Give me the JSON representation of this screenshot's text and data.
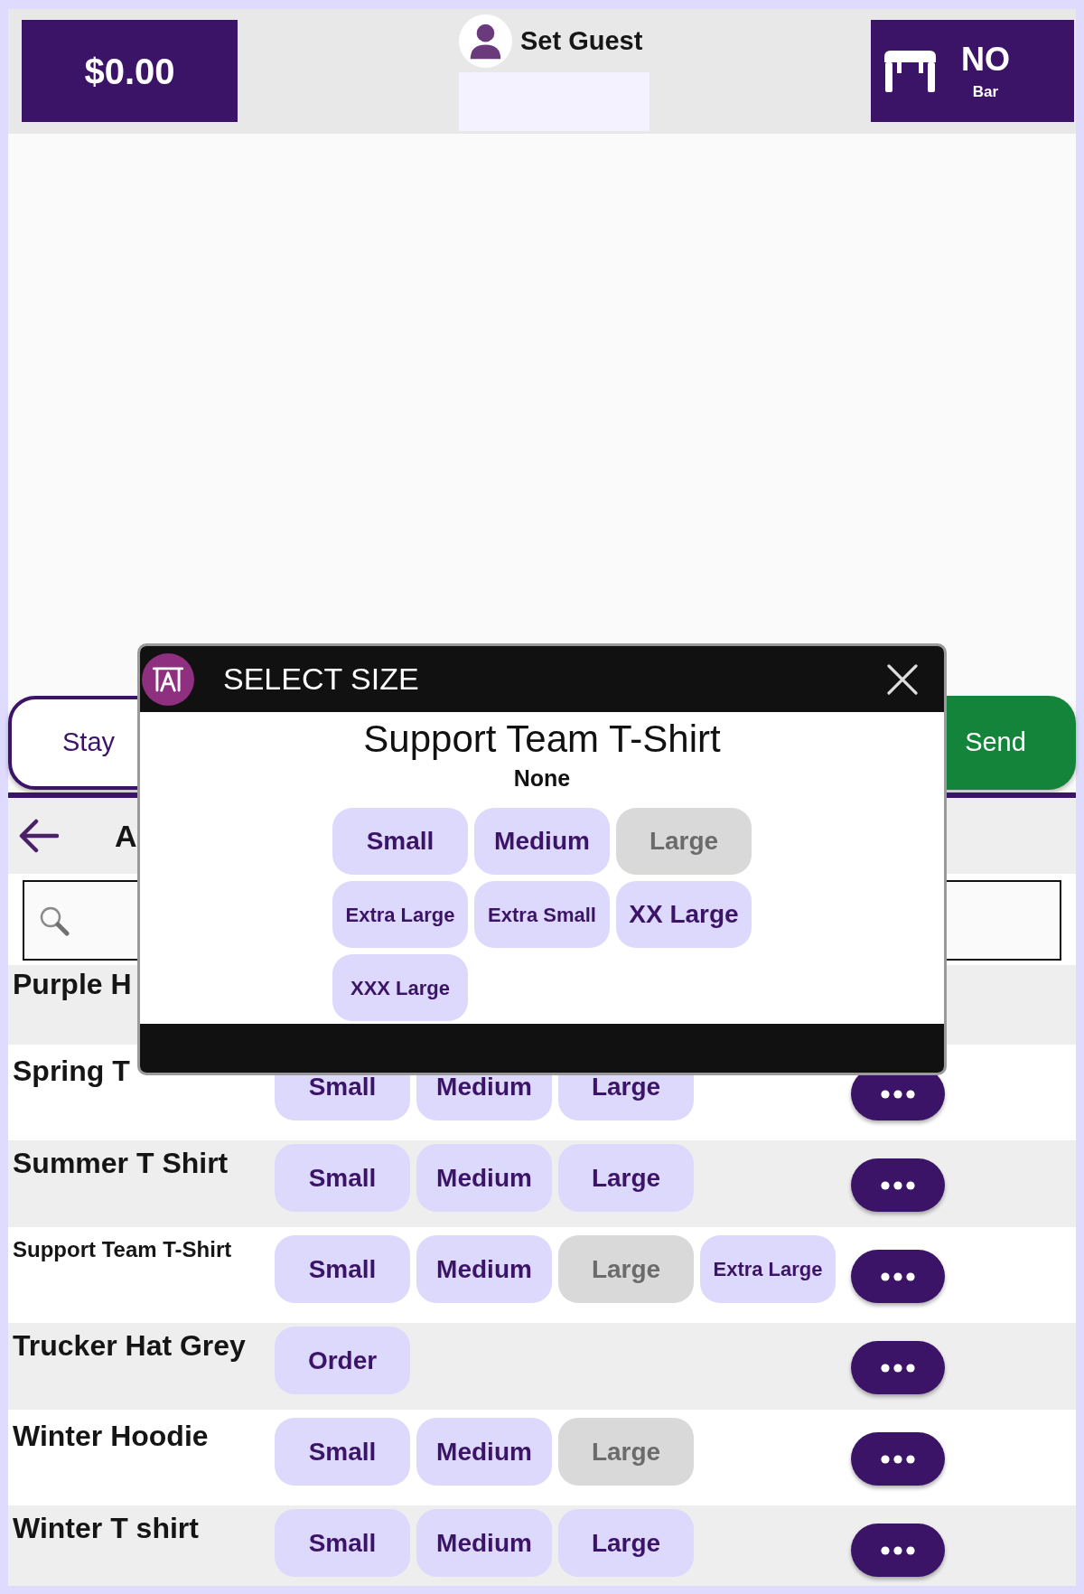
{
  "top_bar": {
    "total": "$0.00",
    "guest_label": "Set Guest",
    "table": {
      "status": "NO",
      "area": "Bar"
    }
  },
  "actions": [
    {
      "kind": "outline",
      "label": "Stay"
    },
    {
      "kind": "primary",
      "label": "Send"
    }
  ],
  "list": {
    "title": "A",
    "items": [
      {
        "name": "Purple H",
        "menu_button": false
      },
      {
        "name": "Spring T",
        "options": [
          {
            "label": "Small",
            "disabled": false
          },
          {
            "label": "Medium",
            "disabled": false
          },
          {
            "label": "Large",
            "disabled": false
          }
        ],
        "menu_button": true
      },
      {
        "name": "Summer T Shirt",
        "options": [
          {
            "label": "Small",
            "disabled": false
          },
          {
            "label": "Medium",
            "disabled": false
          },
          {
            "label": "Large",
            "disabled": false
          }
        ],
        "menu_button": true
      },
      {
        "name": "Support Team T-Shirt",
        "options": [
          {
            "label": "Small",
            "disabled": false
          },
          {
            "label": "Medium",
            "disabled": false
          },
          {
            "label": "Large",
            "disabled": true
          },
          {
            "label": "Extra Large",
            "disabled": false
          }
        ],
        "menu_button": true
      },
      {
        "name": "Trucker Hat Grey",
        "options": [
          {
            "label": "Order",
            "disabled": false
          }
        ],
        "menu_button": true
      },
      {
        "name": "Winter Hoodie",
        "options": [
          {
            "label": "Small",
            "disabled": false
          },
          {
            "label": "Medium",
            "disabled": false
          },
          {
            "label": "Large",
            "disabled": true
          }
        ],
        "menu_button": true
      },
      {
        "name": "Winter T shirt",
        "options": [
          {
            "label": "Small",
            "disabled": false
          },
          {
            "label": "Medium",
            "disabled": false
          },
          {
            "label": "Large",
            "disabled": false
          }
        ],
        "menu_button": true
      }
    ]
  },
  "dialog": {
    "title": "SELECT SIZE",
    "product": "Support Team T-Shirt",
    "selection": "None",
    "options": [
      {
        "label": "Small",
        "disabled": false
      },
      {
        "label": "Medium",
        "disabled": false
      },
      {
        "label": "Large",
        "disabled": true
      },
      {
        "label": "Extra Large",
        "disabled": false
      },
      {
        "label": "Extra Small",
        "disabled": false
      },
      {
        "label": "XX Large",
        "disabled": false
      },
      {
        "label": "XXX Large",
        "disabled": false
      }
    ]
  }
}
